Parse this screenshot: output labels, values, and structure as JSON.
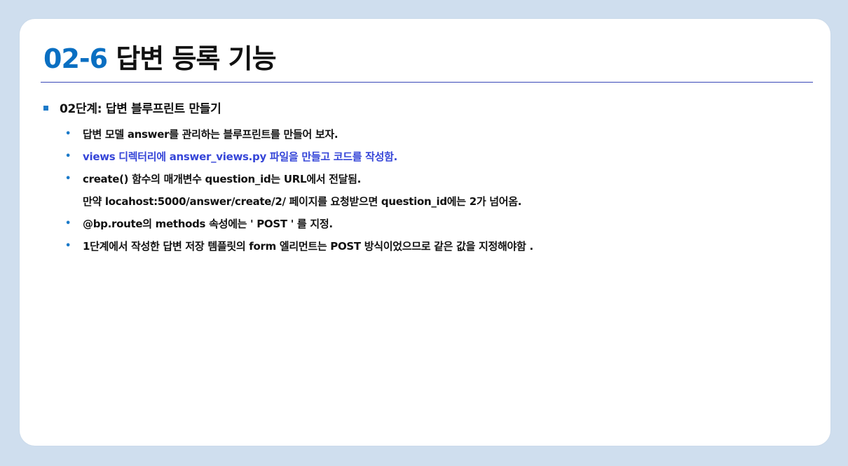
{
  "slide": {
    "title_number": "02-6",
    "title_text": "답변 등록 기능",
    "section": {
      "label": "02단계: 답변 블루프린트 만들기",
      "bullet_color": "#1b7ac9"
    },
    "items": [
      {
        "text": "답변 모델 answer를 관리하는 블루프린트를 만들어 보자."
      },
      {
        "text": "views 디렉터리에 answer_views.py 파일을 만들고 코드를 작성함."
      },
      {
        "text": "create() 함수의 매개변수 question_id는 URL에서 전달됨.",
        "continuation": "만약 locahost:5000/answer/create/2/ 페이지를 요청받으면 question_id에는 2가 넘어옴."
      },
      {
        "text": "@bp.route의 methods 속성에는  ' POST ' 를 지정."
      },
      {
        "text": "1단계에서 작성한 답변 저장 템플릿의 form 엘리먼트는 POST 방식이었으므로 같은 값을 지정해야함 ."
      }
    ]
  },
  "colors": {
    "page_background": "#cfdeee",
    "slide_background": "#ffffff",
    "title_number": "#0a6fc2",
    "rule": "#3a48b8",
    "highlight_text": "#3646d8"
  }
}
